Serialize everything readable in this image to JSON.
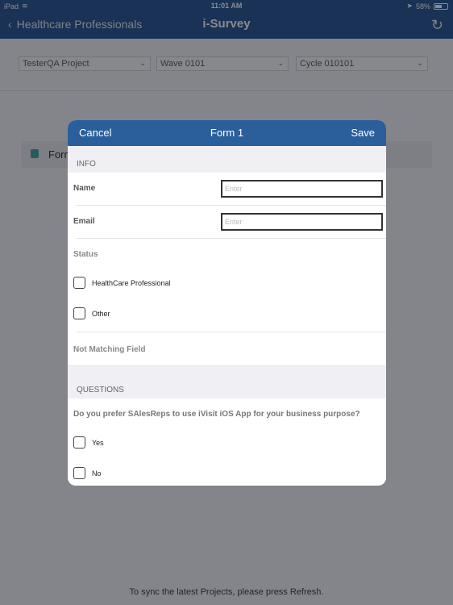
{
  "status_bar": {
    "device": "iPad",
    "time": "11:01 AM",
    "battery": "58%",
    "battery_level": 0.58
  },
  "nav": {
    "back_label": "Healthcare Professionals",
    "title": "i-Survey",
    "refresh_icon": "refresh-icon"
  },
  "filters": [
    {
      "value": "TesterQA Project"
    },
    {
      "value": "Wave 0101"
    },
    {
      "value": "Cycle 010101"
    }
  ],
  "list": {
    "items": [
      {
        "label": "Form 1",
        "icon": "form-icon"
      }
    ]
  },
  "footer_hint": "To sync the latest Projects, please press Refresh.",
  "modal": {
    "cancel_label": "Cancel",
    "title": "Form 1",
    "save_label": "Save",
    "info_section": "INFO",
    "fields": [
      {
        "label": "Name",
        "placeholder": "Enter",
        "value": ""
      },
      {
        "label": "Email",
        "placeholder": "Enter",
        "value": ""
      }
    ],
    "status": {
      "label": "Status",
      "options": [
        {
          "label": "HealthCare Professional",
          "checked": false
        },
        {
          "label": "Other",
          "checked": false
        }
      ]
    },
    "not_matching_label": "Not Matching Field",
    "questions_section": "QUESTIONS",
    "question": {
      "text": "Do you prefer SAlesReps to use iVisit iOS App for your business purpose?",
      "options": [
        {
          "label": "Yes",
          "checked": false
        },
        {
          "label": "No",
          "checked": false
        }
      ]
    }
  },
  "colors": {
    "nav_bg": "#1f4f8c",
    "modal_header_bg": "#2b5f9c",
    "section_bg": "#efeff4"
  }
}
